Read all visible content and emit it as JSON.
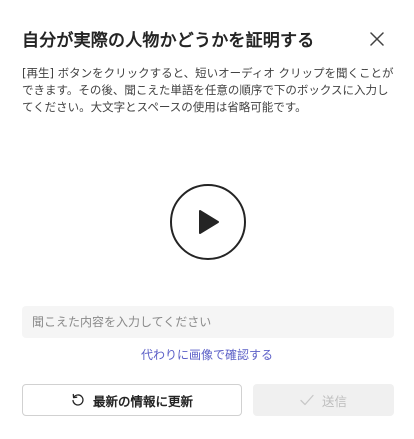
{
  "dialog": {
    "title": "自分が実際の人物かどうかを証明する",
    "description": "[再生] ボタンをクリックすると、短いオーディオ クリップを聞くことができます。その後、聞こえた単語を任意の順序で下のボックスに入力してください。大文字とスペースの使用は省略可能です。",
    "close_icon": "close-icon",
    "play_icon": "play-icon"
  },
  "answer": {
    "value": "",
    "placeholder": "聞こえた内容を入力してください"
  },
  "image_link": "代わりに画像で確認する",
  "buttons": {
    "refresh_label": "最新の情報に更新",
    "refresh_icon": "refresh-icon",
    "submit_label": "送信",
    "submit_icon": "checkmark-icon"
  },
  "colors": {
    "accent": "#5b5fc7",
    "text": "#242424",
    "disabled_text": "#bdbdbd",
    "input_bg": "#f5f5f5"
  }
}
